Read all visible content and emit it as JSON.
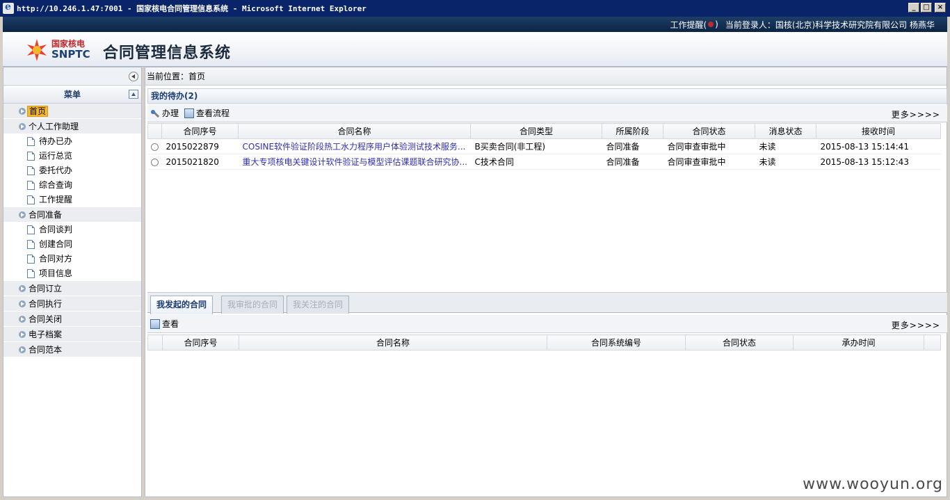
{
  "window": {
    "title": "http://10.246.1.47:7001 - 国家核电合同管理信息系统 - Microsoft Internet Explorer",
    "min": "_",
    "max": "□",
    "close": "×"
  },
  "header": {
    "reminder_label": "工作提醒(",
    "reminder_close": ")",
    "login_label": "当前登录人：国核(北京)科学技术研究院有限公司 杨燕华",
    "logo_cn": "国家核电",
    "logo_en": "SNPTC",
    "app_title": "合同管理信息系统"
  },
  "sidebar": {
    "menu_title": "菜单",
    "items": [
      {
        "type": "group",
        "label": "首页",
        "active": true
      },
      {
        "type": "group",
        "label": "个人工作助理"
      },
      {
        "type": "sub",
        "label": "待办已办"
      },
      {
        "type": "sub",
        "label": "运行总览"
      },
      {
        "type": "sub",
        "label": "委托代办"
      },
      {
        "type": "sub",
        "label": "综合查询"
      },
      {
        "type": "sub",
        "label": "工作提醒"
      },
      {
        "type": "group",
        "label": "合同准备"
      },
      {
        "type": "sub",
        "label": "合同谈判"
      },
      {
        "type": "sub",
        "label": "创建合同"
      },
      {
        "type": "sub",
        "label": "合同对方"
      },
      {
        "type": "sub",
        "label": "项目信息"
      },
      {
        "type": "group",
        "label": "合同订立"
      },
      {
        "type": "group",
        "label": "合同执行"
      },
      {
        "type": "group",
        "label": "合同关闭"
      },
      {
        "type": "group",
        "label": "电子档案"
      },
      {
        "type": "group",
        "label": "合同范本"
      }
    ]
  },
  "main": {
    "breadcrumb": "当前位置：首页",
    "todo": {
      "title": "我的待办(",
      "count": "2",
      "title_close": ")",
      "toolbar": {
        "handle": "办理",
        "view_flow": "查看流程",
        "more": "更多>>>>"
      },
      "columns": [
        "合同序号",
        "合同名称",
        "合同类型",
        "所属阶段",
        "合同状态",
        "消息状态",
        "接收时间"
      ],
      "rows": [
        {
          "no": "2015022879",
          "name": "COSINE软件验证阶段热工水力程序用户体验测试技术服务...",
          "type": "B买卖合同(非工程)",
          "stage": "合同准备",
          "status": "合同审查审批中",
          "msg": "未读",
          "time": "2015-08-13 15:14:41"
        },
        {
          "no": "2015021820",
          "name": "重大专项核电关键设计软件验证与模型评估课题联合研究协...",
          "type": "C技术合同",
          "stage": "合同准备",
          "status": "合同审查审批中",
          "msg": "未读",
          "time": "2015-08-13 15:12:43"
        }
      ]
    },
    "tabs": [
      "我发起的合同",
      "我审批的合同",
      "我关注的合同"
    ],
    "mine": {
      "toolbar": {
        "view": "查看",
        "more": "更多>>>>"
      },
      "columns": [
        "合同序号",
        "合同名称",
        "合同系统编号",
        "合同状态",
        "承办时间"
      ]
    }
  },
  "watermark": "www.wooyun.org",
  "colors": {
    "accent": "#0a246a",
    "active_menu": "#f5b72a",
    "link": "#2f2fb3",
    "header_text": "#1b3c72"
  }
}
